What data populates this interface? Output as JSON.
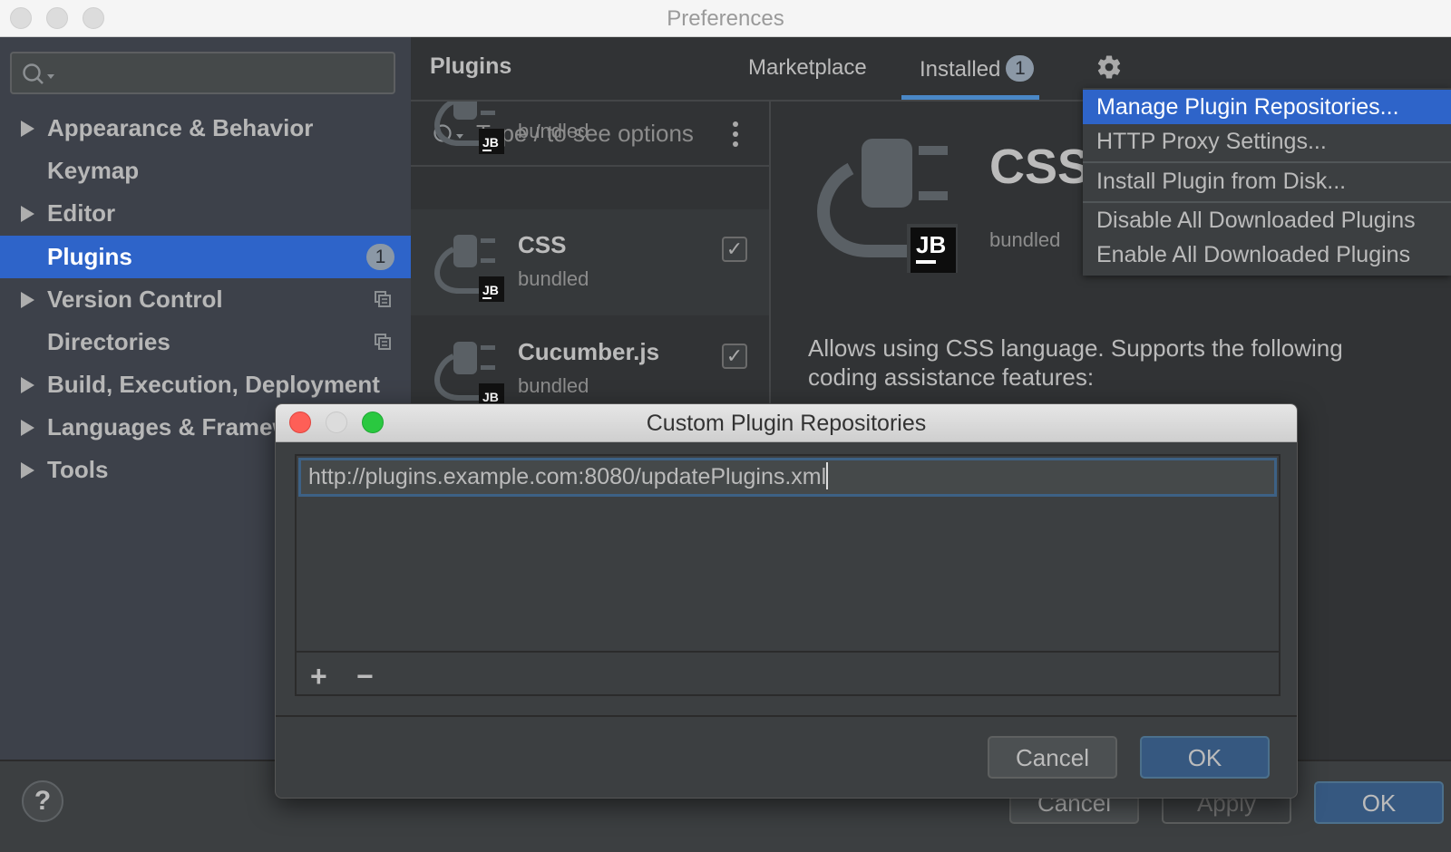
{
  "window": {
    "title": "Preferences"
  },
  "sidebar": {
    "search_placeholder": "",
    "items": [
      {
        "label": "Appearance & Behavior",
        "expandable": true
      },
      {
        "label": "Keymap",
        "expandable": false
      },
      {
        "label": "Editor",
        "expandable": true
      },
      {
        "label": "Plugins",
        "expandable": false,
        "selected": true,
        "badge": "1"
      },
      {
        "label": "Version Control",
        "expandable": true,
        "project_icon": true
      },
      {
        "label": "Directories",
        "expandable": false,
        "project_icon": true
      },
      {
        "label": "Build, Execution, Deployment",
        "expandable": true
      },
      {
        "label": "Languages & Frameworks",
        "expandable": true
      },
      {
        "label": "Tools",
        "expandable": true
      }
    ]
  },
  "plugins": {
    "heading": "Plugins",
    "tabs": [
      {
        "label": "Marketplace",
        "active": false
      },
      {
        "label": "Installed",
        "active": true,
        "badge": "1"
      }
    ],
    "settings_icon": "gear-icon",
    "search_placeholder": "Type / to see options",
    "list": [
      {
        "name": "",
        "vendor": "bundled",
        "enabled": true
      },
      {
        "name": "CSS",
        "vendor": "bundled",
        "enabled": true,
        "selected": true
      },
      {
        "name": "Cucumber.js",
        "vendor": "bundled",
        "enabled": true
      }
    ],
    "detail": {
      "name": "CSS",
      "vendor": "bundled",
      "description": "Allows using CSS language. Supports the following coding assistance features:"
    }
  },
  "gear_menu": {
    "items": [
      {
        "label": "Manage Plugin Repositories...",
        "highlighted": true
      },
      {
        "label": "HTTP Proxy Settings..."
      },
      {
        "label": "Install Plugin from Disk..."
      },
      {
        "label": "Disable All Downloaded Plugins"
      },
      {
        "label": "Enable All Downloaded Plugins"
      }
    ]
  },
  "dialog": {
    "title": "Custom Plugin Repositories",
    "repositories": [
      "http://plugins.example.com:8080/updatePlugins.xml"
    ],
    "add_label": "+",
    "remove_label": "−",
    "cancel_label": "Cancel",
    "ok_label": "OK"
  },
  "footer": {
    "help_label": "?",
    "cancel_label": "Cancel",
    "apply_label": "Apply",
    "ok_label": "OK"
  },
  "colors": {
    "accent": "#2e64c9",
    "primary_button": "#365880",
    "traffic_close": "#fe5f57",
    "traffic_minimize": "#dcdcdc",
    "traffic_zoom": "#2ac840"
  }
}
